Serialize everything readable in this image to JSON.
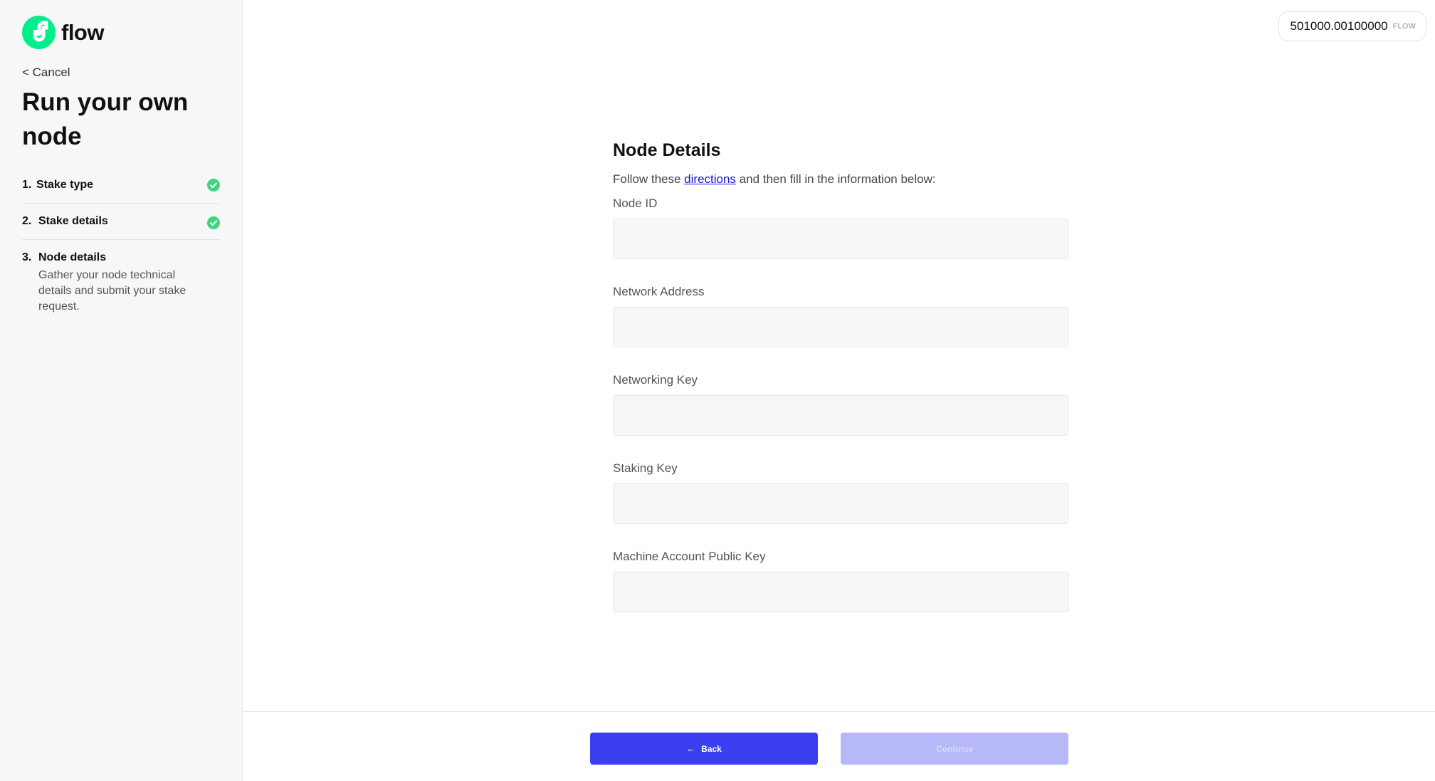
{
  "brand": {
    "name": "flow",
    "logo_icon": "flow-logo-icon",
    "accent_color": "#00ef8b"
  },
  "sidebar": {
    "cancel_label": "< Cancel",
    "title": "Run your own node",
    "steps": [
      {
        "number": "1.",
        "label": "Stake type",
        "status": "complete",
        "icon": "check-circle-icon"
      },
      {
        "number": "2.",
        "label": "Stake details",
        "status": "complete",
        "icon": "check-circle-icon"
      },
      {
        "number": "3.",
        "label": "Node details",
        "status": "current",
        "description": "Gather your node technical details and submit your stake request."
      }
    ]
  },
  "header": {
    "balance_amount": "501000.00100000",
    "balance_unit": "FLOW"
  },
  "form": {
    "title": "Node Details",
    "intro_before": "Follow these ",
    "intro_link": "directions",
    "intro_after": " and then fill in the information below:",
    "fields": [
      {
        "label": "Node ID",
        "value": ""
      },
      {
        "label": "Network Address",
        "value": ""
      },
      {
        "label": "Networking Key",
        "value": ""
      },
      {
        "label": "Staking Key",
        "value": ""
      },
      {
        "label": "Machine Account Public Key",
        "value": ""
      }
    ]
  },
  "footer": {
    "back_label": "Back",
    "back_icon": "arrow-left-icon",
    "continue_label": "Continue",
    "primary_color": "#3b3ff0",
    "disabled_color": "#b6b8f7"
  }
}
